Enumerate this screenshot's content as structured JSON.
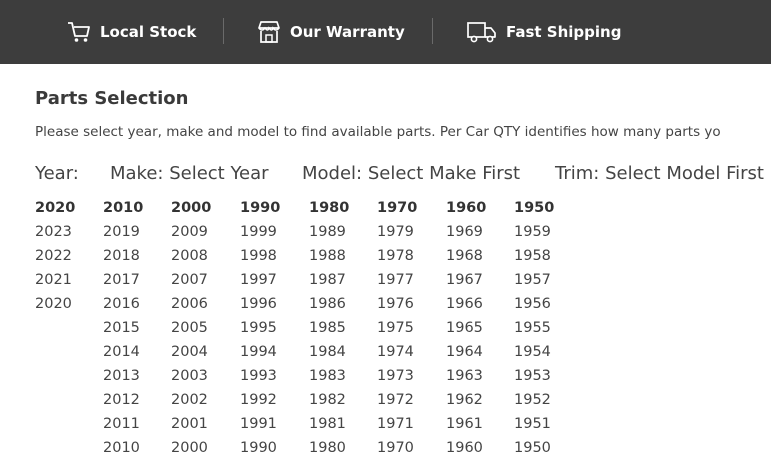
{
  "topbar": {
    "items": [
      {
        "label": "Local Stock",
        "icon": "cart-icon"
      },
      {
        "label": "Our Warranty",
        "icon": "store-icon"
      },
      {
        "label": "Fast Shipping",
        "icon": "truck-icon"
      }
    ]
  },
  "parts": {
    "title": "Parts Selection",
    "intro": "Please select year, make and model to find available parts. Per Car QTY identifies how many parts yo"
  },
  "filters": {
    "year": "Year:",
    "make": "Make: Select Year",
    "model": "Model: Select Make First",
    "trim": "Trim: Select Model First"
  },
  "years": [
    {
      "header": "2020",
      "items": [
        "2023",
        "2022",
        "2021",
        "2020"
      ]
    },
    {
      "header": "2010",
      "items": [
        "2019",
        "2018",
        "2017",
        "2016",
        "2015",
        "2014",
        "2013",
        "2012",
        "2011",
        "2010"
      ]
    },
    {
      "header": "2000",
      "items": [
        "2009",
        "2008",
        "2007",
        "2006",
        "2005",
        "2004",
        "2003",
        "2002",
        "2001",
        "2000"
      ]
    },
    {
      "header": "1990",
      "items": [
        "1999",
        "1998",
        "1997",
        "1996",
        "1995",
        "1994",
        "1993",
        "1992",
        "1991",
        "1990"
      ]
    },
    {
      "header": "1980",
      "items": [
        "1989",
        "1988",
        "1987",
        "1986",
        "1985",
        "1984",
        "1983",
        "1982",
        "1981",
        "1980"
      ]
    },
    {
      "header": "1970",
      "items": [
        "1979",
        "1978",
        "1977",
        "1976",
        "1975",
        "1974",
        "1973",
        "1972",
        "1971",
        "1970"
      ]
    },
    {
      "header": "1960",
      "items": [
        "1969",
        "1968",
        "1967",
        "1966",
        "1965",
        "1964",
        "1963",
        "1962",
        "1961",
        "1960"
      ]
    },
    {
      "header": "1950",
      "items": [
        "1959",
        "1958",
        "1957",
        "1956",
        "1955",
        "1954",
        "1953",
        "1952",
        "1951",
        "1950"
      ]
    }
  ]
}
